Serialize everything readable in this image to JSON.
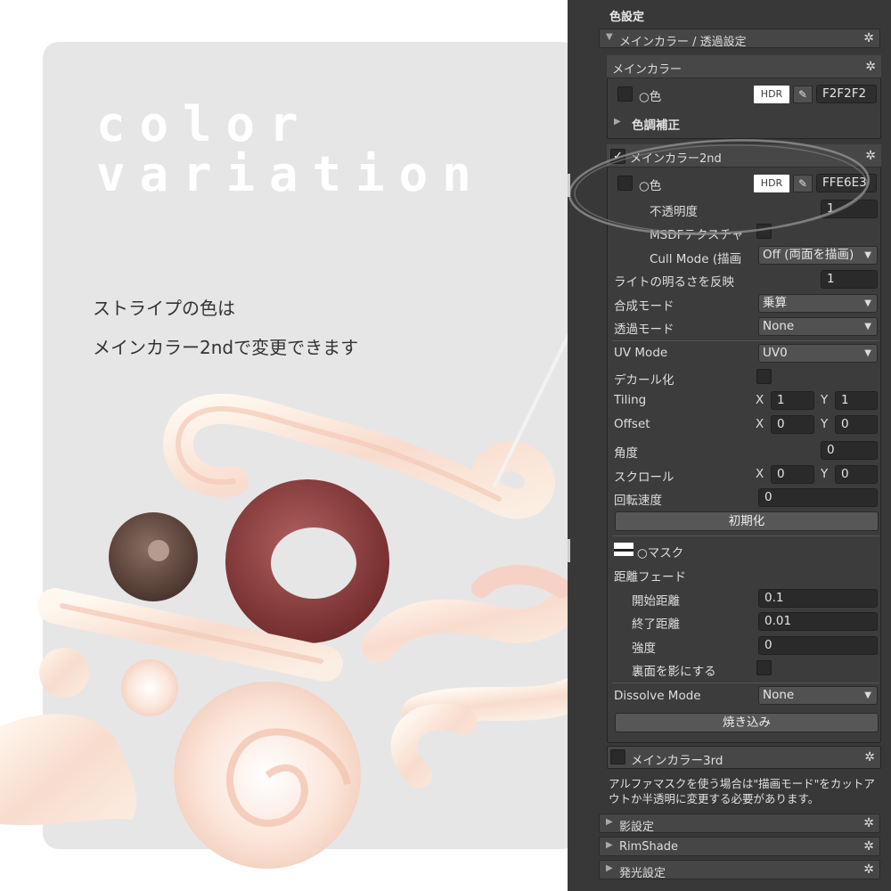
{
  "showcase": {
    "title_line1": "color",
    "title_line2": "variation",
    "desc_line1": "ストライプの色は",
    "desc_line2": "メインカラー2ndで変更できます"
  },
  "panel": {
    "section_title": "色設定",
    "main_color_fold": {
      "label": "メインカラー / 透過設定"
    },
    "main_color": {
      "header": "メインカラー",
      "color_label": "○色",
      "hdr": "HDR",
      "hex": "F2F2F2",
      "tone_correction": "色調補正"
    },
    "main_color_2nd": {
      "header": "メインカラー2nd",
      "checked": true,
      "color_label": "○色",
      "hdr": "HDR",
      "hex": "FFE6E3",
      "opacity_label": "不透明度",
      "opacity_value": "1",
      "msdf_label": "MSDFテクスチャ",
      "cull_label": "Cull Mode (描画",
      "cull_value": "Off (両面を描画)",
      "light_label": "ライトの明るさを反映",
      "light_value": "1",
      "blend_label": "合成モード",
      "blend_value": "乗算",
      "alpha_label": "透過モード",
      "alpha_value": "None",
      "uv_label": "UV Mode",
      "uv_value": "UV0",
      "decal_label": "デカール化",
      "tiling_label": "Tiling",
      "tiling_x": "1",
      "tiling_y": "1",
      "offset_label": "Offset",
      "offset_x": "0",
      "offset_y": "0",
      "angle_label": "角度",
      "angle_value": "0",
      "scroll_label": "スクロール",
      "scroll_x": "0",
      "scroll_y": "0",
      "rot_speed_label": "回転速度",
      "rot_speed_value": "0",
      "init_button": "初期化",
      "mask_label": "○マスク",
      "distance_fade_label": "距離フェード",
      "fade_start_label": "開始距離",
      "fade_start_value": "0.1",
      "fade_end_label": "終了距離",
      "fade_end_value": "0.01",
      "strength_label": "強度",
      "strength_value": "0",
      "backface_label": "裏面を影にする",
      "dissolve_label": "Dissolve Mode",
      "dissolve_value": "None",
      "bake_button": "焼き込み",
      "x_label": "X",
      "y_label": "Y"
    },
    "main_color_3rd": {
      "header": "メインカラー3rd"
    },
    "note": "アルファマスクを使う場合は\"描画モード\"をカットアウトか半透明に変更する必要があります。",
    "shadow_fold": {
      "label": "影設定"
    },
    "rimshade_fold": {
      "label": "RimShade"
    },
    "emission_fold": {
      "label": "発光設定"
    }
  },
  "colors": {
    "panel_bg": "#383838",
    "showcase_bg": "#e6e6e7",
    "stripe_pink": "#f6d2c6",
    "cream": "#fbf1e6",
    "choco": "#5a4139",
    "berry": "#8c3a3a"
  }
}
